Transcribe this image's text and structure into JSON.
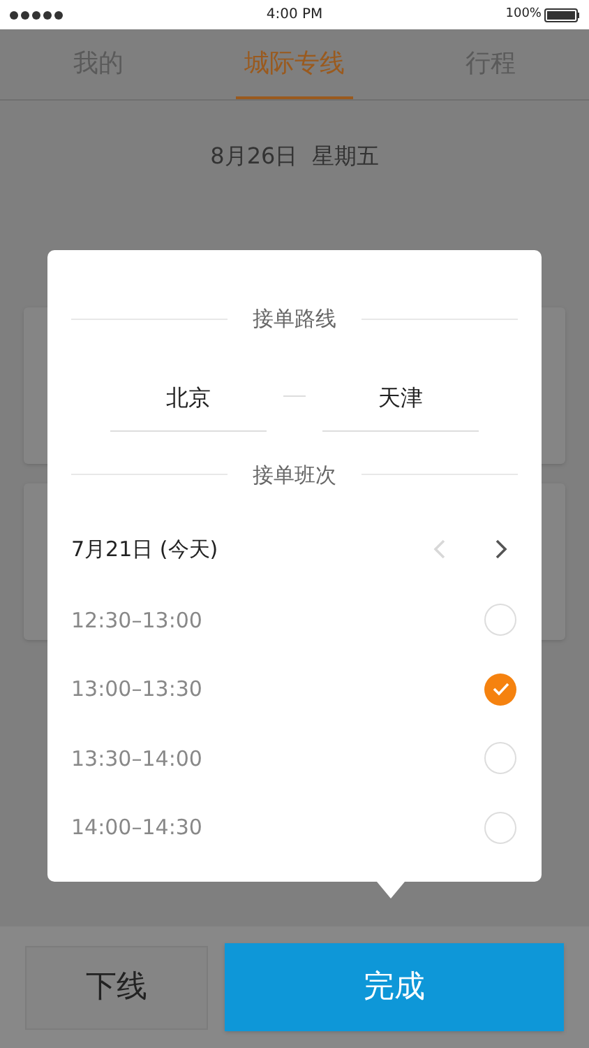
{
  "status_bar": {
    "time": "4:00 PM",
    "battery": "100%"
  },
  "tabs": [
    {
      "label": "我的",
      "selected": false
    },
    {
      "label": "城际专线",
      "selected": true
    },
    {
      "label": "行程",
      "selected": false
    }
  ],
  "date": "8月26日  星期五",
  "popup": {
    "route_title": "接单路线",
    "from": "北京",
    "to": "天津",
    "schedule_title": "接单班次",
    "day": "7月21日 (今天)",
    "prev_disabled": true,
    "next_disabled": false,
    "slots": [
      {
        "time": "12:30–13:00",
        "selected": false
      },
      {
        "time": "13:00–13:30",
        "selected": true
      },
      {
        "time": "13:30–14:00",
        "selected": false
      },
      {
        "time": "14:00–14:30",
        "selected": false
      }
    ]
  },
  "buttons": {
    "offline": "下线",
    "done": "完成"
  }
}
